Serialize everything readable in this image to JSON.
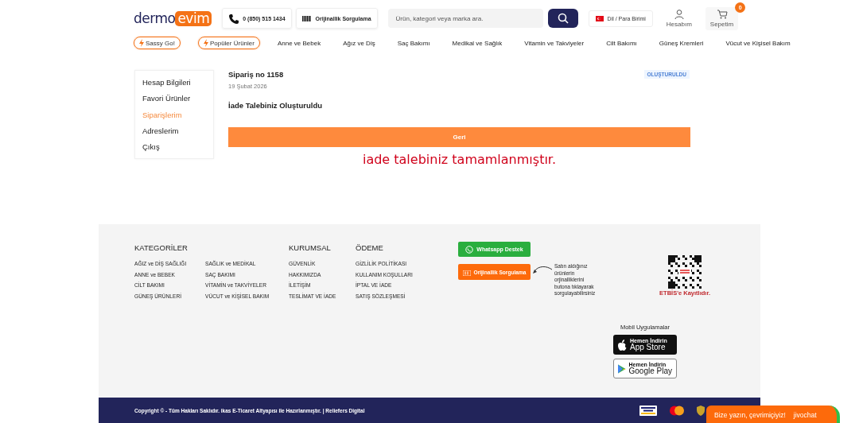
{
  "header": {
    "logo": {
      "part1": "dermo",
      "part2": "evim"
    },
    "phone": "0 (850) 515 1434",
    "verify_button": "Orijinallik Sorgulama",
    "search": {
      "placeholder": "Ürün, kategori veya marka ara."
    },
    "language_button": "Dil / Para Birimi",
    "account": "Hesabım",
    "cart": {
      "label": "Sepetim",
      "count": "0"
    }
  },
  "nav": [
    {
      "label": "Sassy Go!",
      "kind": "pill"
    },
    {
      "label": "Popüler Ürünler",
      "kind": "pill"
    },
    {
      "label": "Anne ve Bebek",
      "kind": "link"
    },
    {
      "label": "Ağız ve Diş",
      "kind": "link"
    },
    {
      "label": "Saç Bakımı",
      "kind": "link"
    },
    {
      "label": "Medikal ve Sağlık",
      "kind": "link"
    },
    {
      "label": "Vitamin ve Takviyeler",
      "kind": "link"
    },
    {
      "label": "Cilt Bakımı",
      "kind": "link"
    },
    {
      "label": "Güneş Kremleri",
      "kind": "link"
    },
    {
      "label": "Vücut ve Kişisel Bakım",
      "kind": "link"
    }
  ],
  "sidebar": {
    "items": [
      {
        "label": "Hesap Bilgileri",
        "selected": false
      },
      {
        "label": "Favori Ürünler",
        "selected": false
      },
      {
        "label": "Siparişlerim",
        "selected": true
      },
      {
        "label": "Adreslerim",
        "selected": false
      },
      {
        "label": "Çıkış",
        "selected": false
      }
    ]
  },
  "order": {
    "title": "Sipariş no 1158",
    "date": "19 Şubat 2026",
    "status": "OLUŞTURULDU",
    "message": "İade Talebiniz Oluşturuldu",
    "back_button": "Geri",
    "notice": "iade talebiniz tamamlanmıştır."
  },
  "footer": {
    "columns": [
      {
        "title": "KATEGORİLER",
        "links": [
          "AĞIZ ve DİŞ SAĞLIĞI",
          "ANNE ve BEBEK",
          "CİLT BAKIMI",
          "GÜNEŞ ÜRÜNLERİ"
        ]
      },
      {
        "links": [
          "SAĞLIK ve MEDİKAL",
          "SAÇ BAKIMI",
          "VİTAMİN ve TAKVİYELER",
          "VÜCUT ve KİŞİSEL BAKIM"
        ]
      },
      {
        "title": "KURUMSAL",
        "links": [
          "GÜVENLİK",
          "HAKKIMIZDA",
          "İLETİŞİM",
          "TESLİMAT VE İADE"
        ]
      },
      {
        "title": "ÖDEME",
        "links": [
          "GİZLİLİK POLİTİKASI",
          "KULLANIM KOŞULLARI",
          "İPTAL VE İADE",
          "SATIŞ SÖZLEŞMESİ"
        ]
      }
    ],
    "whatsapp_button": "Whatsapp Destek",
    "verify_button": "Orijinallik Sorgulama",
    "verify_note": "Satın aldığınız ürünlerin orjinalliklerini butona tıklayarak sorgulayabilirsiniz",
    "etbis_label": "ETBİS'e Kayıtlıdır.",
    "apps_title": "Mobil Uygulamalar",
    "app_store": {
      "small": "Hemen İndirin",
      "big": "App Store"
    },
    "google_play": {
      "small": "Hemen İndirin",
      "big": "Google Play"
    }
  },
  "bottom_bar": {
    "copyright": "Copyright © - Tüm Hakları Saklıdır. ikas E-Ticaret Altyapısı ile Hazırlanmıştır. | Reliefers Digital"
  },
  "chat": {
    "text": "Bize yazın, çevrimiçiyiz!",
    "brand": "jivochat"
  }
}
